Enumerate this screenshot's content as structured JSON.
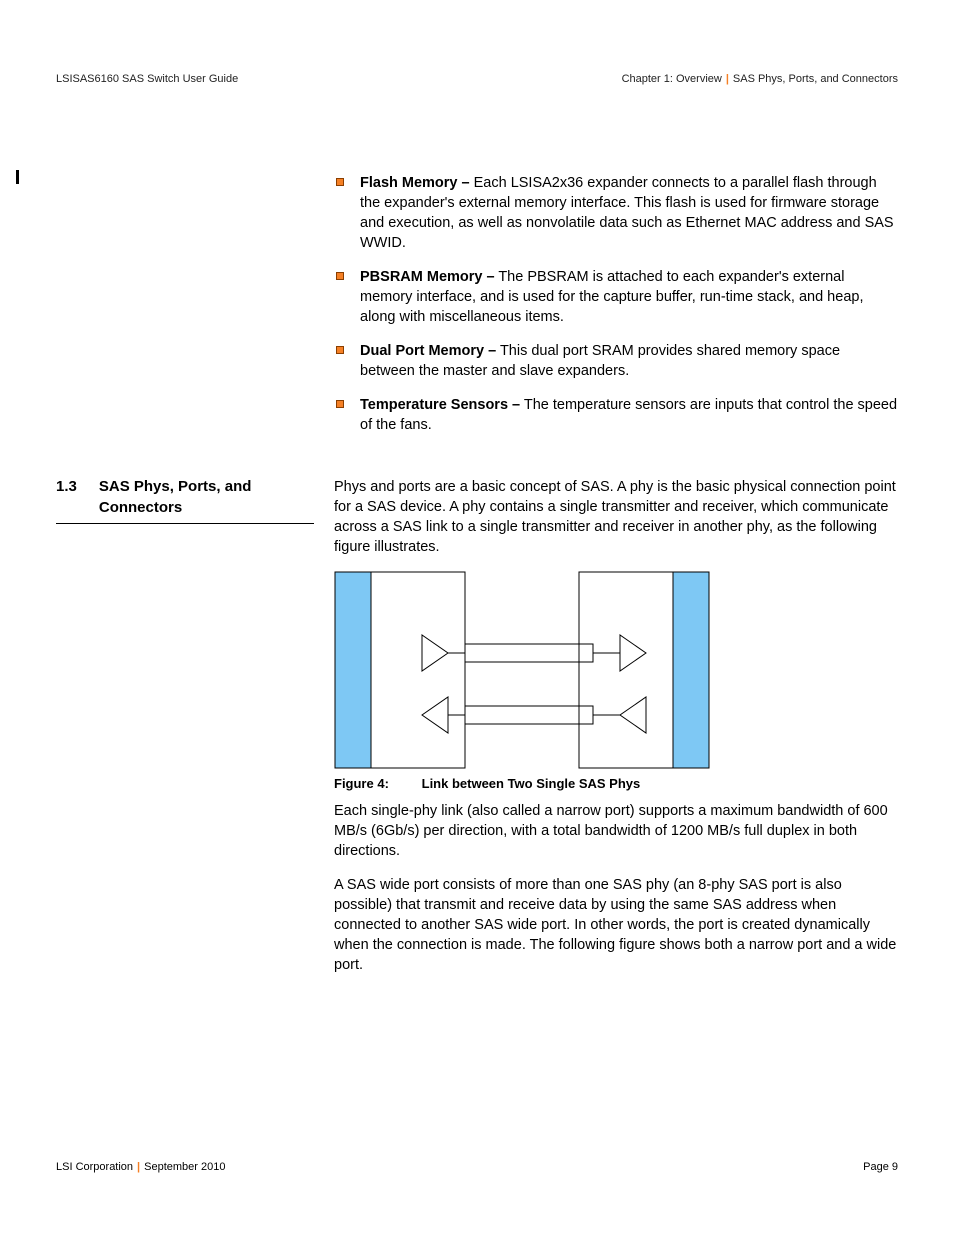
{
  "header": {
    "left": "LSISAS6160 SAS Switch User Guide",
    "right_chapter": "Chapter 1: Overview",
    "right_section": "SAS Phys, Ports, and Connectors"
  },
  "bullets": [
    {
      "term": "Flash Memory –",
      "text": " Each LSISA2x36 expander connects to a parallel flash through the expander's external memory interface. This flash is used for firmware storage and execution, as well as nonvolatile data such as Ethernet MAC address and SAS WWID."
    },
    {
      "term": "PBSRAM Memory –",
      "text": " The PBSRAM is attached to each expander's external memory interface, and is used for the capture buffer, run-time stack, and heap, along with miscellaneous items."
    },
    {
      "term": "Dual Port Memory –",
      "text": " This dual port SRAM provides shared memory space between the master and slave expanders."
    },
    {
      "term": "Temperature Sensors –",
      "text": " The temperature sensors are inputs that control the speed of the fans."
    }
  ],
  "section": {
    "number": "1.3",
    "title": "SAS Phys, Ports, and Connectors",
    "intro": "Phys and ports are a basic concept of SAS. A phy is the basic physical connection point for a SAS device. A phy contains a single transmitter and receiver, which communicate across a SAS link to a single transmitter and receiver in another phy, as the following figure illustrates.",
    "figure": {
      "label": "Figure 4:",
      "caption": "Link between Two Single SAS Phys"
    },
    "para2": "Each single-phy link (also called a narrow port) supports a maximum bandwidth of 600 MB/s (6Gb/s) per direction, with a total bandwidth of 1200 MB/s full duplex in both directions.",
    "para3": "A SAS wide port consists of more than one SAS phy (an 8-phy SAS port is also possible) that transmit and receive data by using the same SAS address when connected to another SAS wide port. In other words, the port is created dynamically when the connection is made. The following figure shows both a narrow port and a wide port."
  },
  "footer": {
    "company": "LSI Corporation",
    "date": "September 2010",
    "page": "Page 9"
  }
}
